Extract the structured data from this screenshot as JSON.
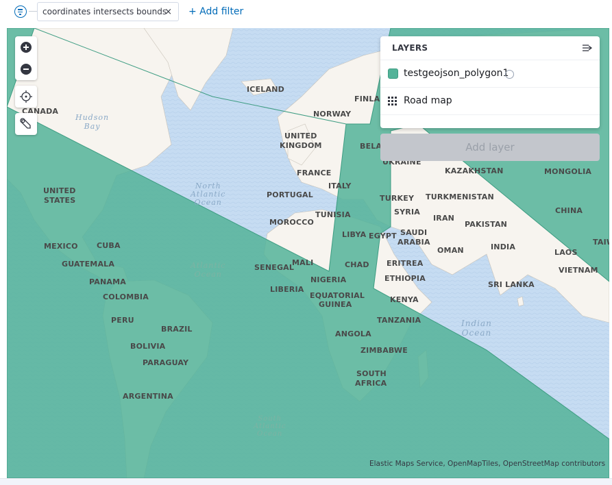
{
  "filter_bar": {
    "pill_label": "coordinates intersects bounds",
    "pill_close": "×",
    "add_filter_label": "+ Add filter"
  },
  "layers_panel": {
    "title": "LAYERS",
    "layers": [
      {
        "name": "testgeojson_polygon1",
        "type": "document",
        "color": "#54b399"
      },
      {
        "name": "Road map",
        "type": "basemap"
      }
    ],
    "add_layer_label": "Add layer"
  },
  "map": {
    "attribution": "Elastic Maps Service, OpenMapTiles, OpenStreetMap contributors",
    "polygon_fill": "#54b399",
    "ocean_color": "#c6dcf2",
    "land_color": "#f7f4ef",
    "labels": {
      "iceland": "ICELAND",
      "canada": "CANADA",
      "norway": "NORWAY",
      "finland": "FINLAN",
      "belarus": "BELAI",
      "ukraine": "UKRAINE",
      "uk_line1": "UNITED",
      "uk_line2": "KINGDOM",
      "france": "FRANCE",
      "italy": "ITALY",
      "portugal": "PORTUGAL",
      "tunisia": "TUNISIA",
      "morocco": "MOROCCO",
      "libya": "LIBYA",
      "egypt": "EGYPT",
      "turkey": "TURKEY",
      "syria": "SYRIA",
      "iran": "IRAN",
      "saudi_line1": "SAUDI",
      "saudi_line2": "ARABIA",
      "oman": "OMAN",
      "kazakhstan": "KAZAKHSTAN",
      "turkmenistan": "TURKMENISTAN",
      "pakistan": "PAKISTAN",
      "india": "INDIA",
      "mongolia": "MONGOLIA",
      "china": "CHINA",
      "taiwan": "TAIW",
      "laos": "LAOS",
      "vietnam": "VIETNAM",
      "sri_lanka": "SRI LANKA",
      "us_line1": "UNITED",
      "us_line2": "STATES",
      "mexico": "MEXICO",
      "cuba": "CUBA",
      "guatemala": "GUATEMALA",
      "panama": "PANAMA",
      "colombia": "COLOMBIA",
      "peru": "PERU",
      "brazil": "BRAZIL",
      "bolivia": "BOLIVIA",
      "paraguay": "PARAGUAY",
      "argentina": "ARGENTINA",
      "mali": "MALI",
      "senegal": "SENEGAL",
      "chad": "CHAD",
      "nigeria": "NIGERIA",
      "liberia": "LIBERIA",
      "eq_guinea_line1": "EQUATORIAL",
      "eq_guinea_line2": "GUINEA",
      "eritrea": "ERITREA",
      "ethiopia": "ETHIOPIA",
      "kenya": "KENYA",
      "tanzania": "TANZANIA",
      "angola": "ANGOLA",
      "zimbabwe": "ZIMBABWE",
      "south_africa_line1": "SOUTH",
      "south_africa_line2": "AFRICA",
      "hudson_line1": "Hudson",
      "hudson_line2": "Bay",
      "north_atlantic_line1": "North",
      "north_atlantic_line2": "Atlantic",
      "north_atlantic_line3": "Ocean",
      "atlantic_line1": "Atlantic",
      "atlantic_line2": "Ocean",
      "south_atlantic_line1": "South",
      "south_atlantic_line2": "Atlantic",
      "south_atlantic_line3": "Ocean",
      "indian_line1": "Indian",
      "indian_line2": "Ocean"
    }
  }
}
